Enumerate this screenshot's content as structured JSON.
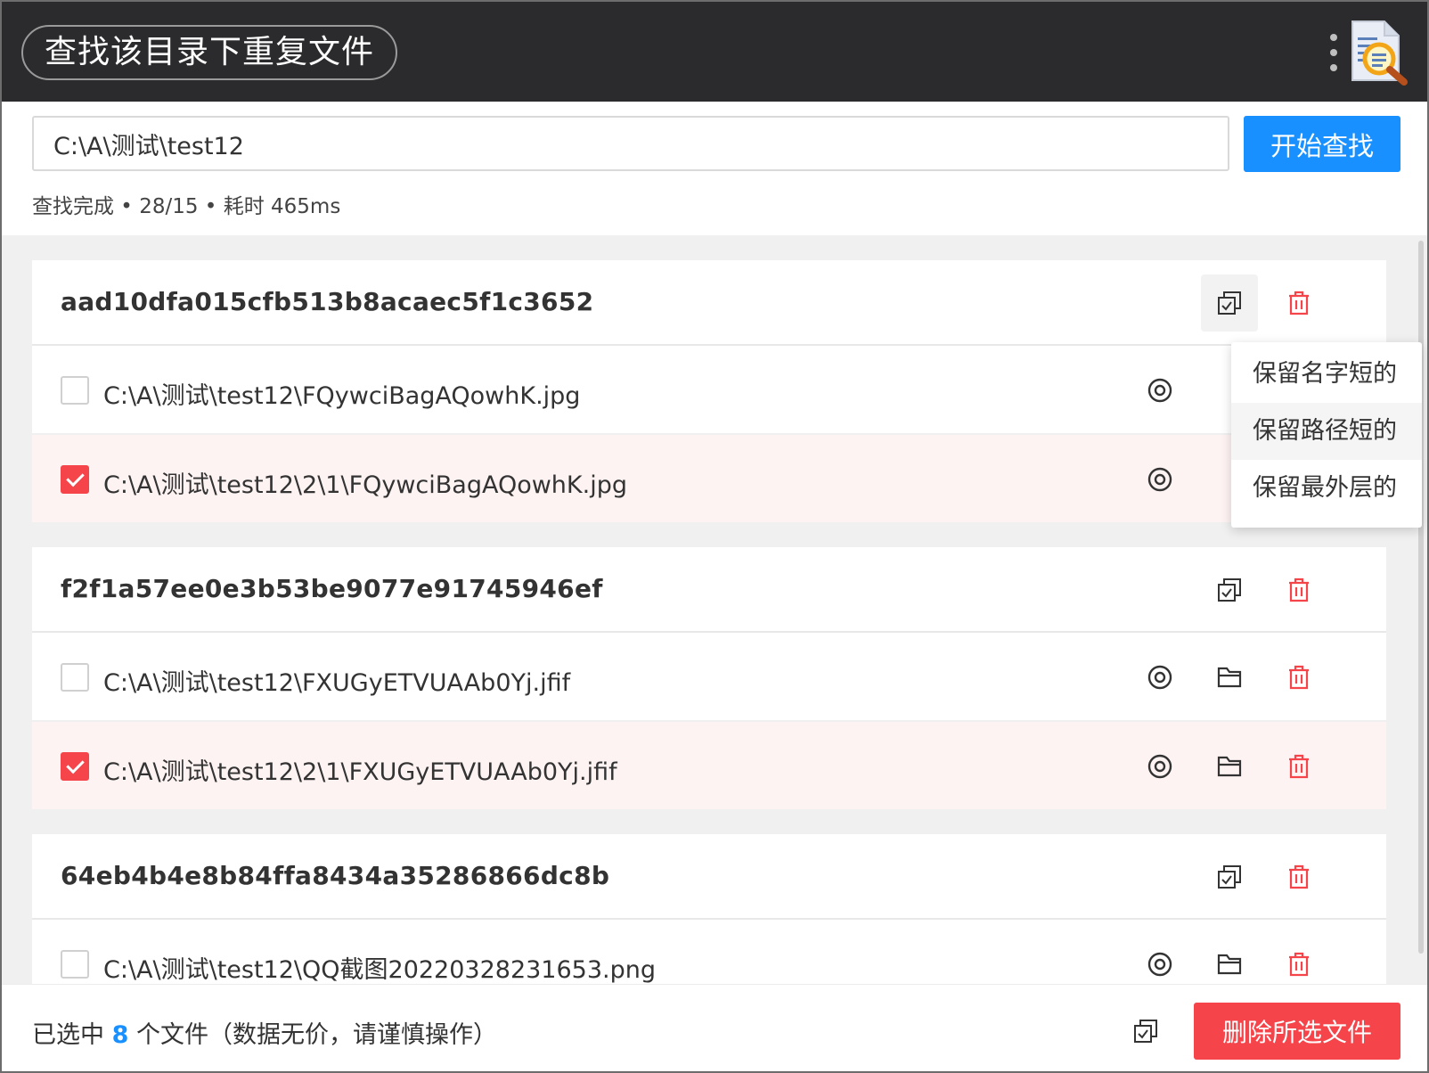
{
  "window": {
    "title": "查找该目录下重复文件"
  },
  "search": {
    "path_value": "C:\\A\\测试\\test12",
    "start_label": "开始查找",
    "status": {
      "state": "查找完成",
      "counts": "28/15",
      "elapsed": "耗时 465ms",
      "separator": " • "
    }
  },
  "groups": [
    {
      "hash": "aad10dfa015cfb513b8acaec5f1c3652",
      "files": [
        {
          "path": "C:\\A\\测试\\test12\\FQywciBagAQowhK.jpg",
          "checked": false
        },
        {
          "path": "C:\\A\\测试\\test12\\2\\1\\FQywciBagAQowhK.jpg",
          "checked": true
        }
      ]
    },
    {
      "hash": "f2f1a57ee0e3b53be9077e91745946ef",
      "files": [
        {
          "path": "C:\\A\\测试\\test12\\FXUGyETVUAAb0Yj.jfif",
          "checked": false
        },
        {
          "path": "C:\\A\\测试\\test12\\2\\1\\FXUGyETVUAAb0Yj.jfif",
          "checked": true
        }
      ]
    },
    {
      "hash": "64eb4b4e8b84ffa8434a35286866dc8b",
      "files": [
        {
          "path": "C:\\A\\测试\\test12\\QQ截图20220328231653.png",
          "checked": false
        }
      ]
    }
  ],
  "dropdown": {
    "items": [
      "保留名字短的",
      "保留路径短的",
      "保留最外层的"
    ]
  },
  "footer": {
    "selected_prefix": "已选中",
    "selected_count": "8",
    "selected_suffix": "个文件（数据无价，请谨慎操作）",
    "delete_label": "删除所选文件"
  },
  "icons": {
    "select": "multi-check-icon",
    "delete": "trash-icon",
    "preview": "eye-icon",
    "folder": "folder-icon",
    "more": "more-vertical-icon",
    "logo": "document-search-logo"
  },
  "colors": {
    "accent": "#1890ff",
    "danger": "#f5454a",
    "titlebar": "#2b2b2d",
    "checked_row": "#fef3f3"
  }
}
